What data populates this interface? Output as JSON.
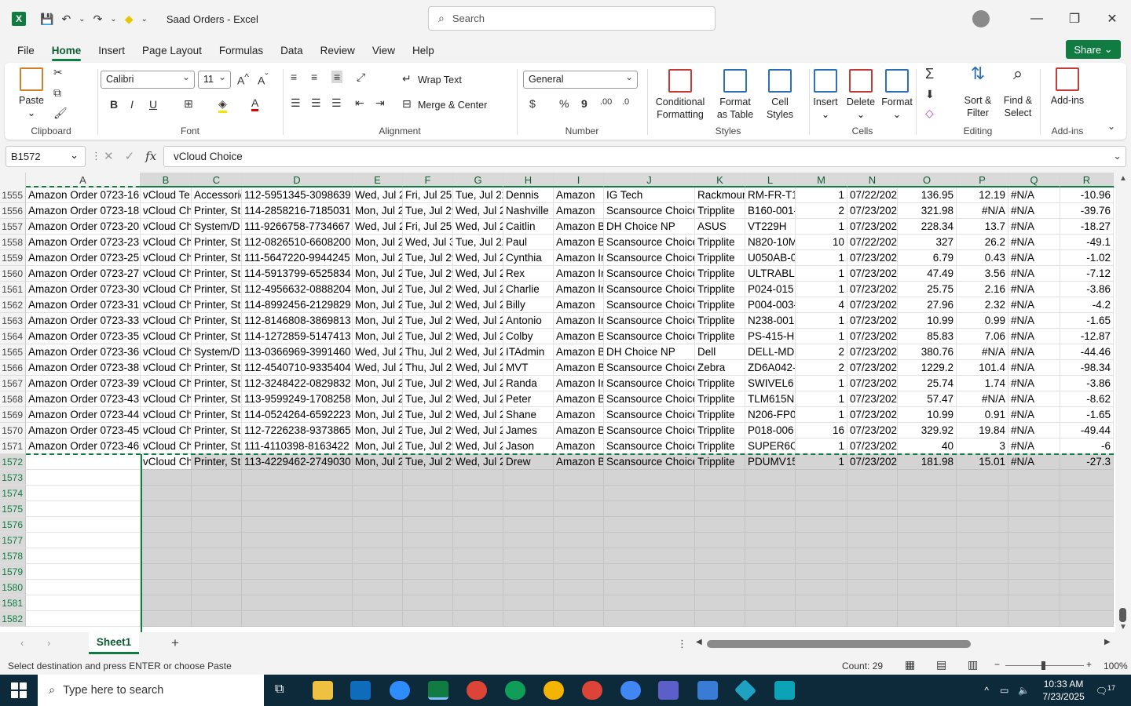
{
  "window": {
    "app_title": "Saad Orders  -  Excel",
    "search_placeholder": "Search"
  },
  "tabs": [
    "File",
    "Home",
    "Insert",
    "Page Layout",
    "Formulas",
    "Data",
    "Review",
    "View",
    "Help"
  ],
  "share_label": "Share",
  "ribbon": {
    "clipboard": {
      "paste": "Paste",
      "label": "Clipboard"
    },
    "font": {
      "name": "Calibri",
      "size": "11",
      "label": "Font"
    },
    "alignment": {
      "wrap": "Wrap Text",
      "merge": "Merge & Center",
      "label": "Alignment"
    },
    "number": {
      "format": "General",
      "label": "Number"
    },
    "styles": {
      "conditional": "Conditional Formatting",
      "table": "Format as Table",
      "cell": "Cell Styles",
      "label": "Styles"
    },
    "cells": {
      "insert": "Insert",
      "delete": "Delete",
      "format": "Format",
      "label": "Cells"
    },
    "editing": {
      "sort": "Sort & Filter",
      "find": "Find & Select",
      "label": "Editing"
    },
    "addins": {
      "addins": "Add-ins",
      "label": "Add-ins"
    }
  },
  "formula_bar": {
    "name_box": "B1572",
    "value": "vCloud Choice"
  },
  "columns": [
    "A",
    "B",
    "C",
    "D",
    "E",
    "F",
    "G",
    "H",
    "I",
    "J",
    "K",
    "L",
    "M",
    "N",
    "O",
    "P",
    "Q",
    "R"
  ],
  "rows": [
    {
      "n": "1555",
      "c": [
        "Amazon Order 0723-16",
        "vCloud Te",
        "Accessorie",
        "112-5951345-3098639",
        "Wed, Jul 2",
        "Fri, Jul 25,",
        "Tue, Jul 22",
        "Dennis",
        "Amazon",
        "IG Tech",
        "Rackmoun",
        "RM-FR-T1",
        "1",
        "07/22/202",
        "136.95",
        "12.19",
        "#N/A",
        "-10.96"
      ]
    },
    {
      "n": "1556",
      "c": [
        "Amazon Order 0723-18",
        "vCloud Ch",
        "Printer, St",
        "114-2858216-7185031",
        "Mon, Jul 2",
        "Tue, Jul 29",
        "Wed, Jul 2",
        "Nashville",
        "Amazon",
        "Scansource Choice",
        "Tripplite",
        "B160-001-",
        "2",
        "07/23/202",
        "321.98",
        "#N/A",
        "#N/A",
        "-39.76"
      ]
    },
    {
      "n": "1557",
      "c": [
        "Amazon Order 0723-20",
        "vCloud Ch",
        "System/D",
        "111-9266758-7734667",
        "Wed, Jul 2",
        "Fri, Jul 25,",
        "Wed, Jul 2",
        "Caitlin",
        "Amazon B",
        "DH Choice NP",
        "ASUS",
        "VT229H",
        "1",
        "07/23/202",
        "228.34",
        "13.7",
        "#N/A",
        "-18.27"
      ]
    },
    {
      "n": "1558",
      "c": [
        "Amazon Order 0723-23",
        "vCloud Ch",
        "Printer, St",
        "112-0826510-6608200",
        "Mon, Jul 2",
        "Wed, Jul 3",
        "Tue, Jul 22",
        "Paul",
        "Amazon B",
        "Scansource Choice",
        "Tripplite",
        "N820-10M",
        "10",
        "07/22/202",
        "327",
        "26.2",
        "#N/A",
        "-49.1"
      ]
    },
    {
      "n": "1559",
      "c": [
        "Amazon Order 0723-25",
        "vCloud Ch",
        "Printer, St",
        "111-5647220-9944245",
        "Mon, Jul 2",
        "Tue, Jul 29",
        "Wed, Jul 2",
        "Cynthia",
        "Amazon Ir",
        "Scansource Choice",
        "Tripplite",
        "U050AB-0",
        "1",
        "07/23/202",
        "6.79",
        "0.43",
        "#N/A",
        "-1.02"
      ]
    },
    {
      "n": "1560",
      "c": [
        "Amazon Order 0723-27",
        "vCloud Ch",
        "Printer, St",
        "114-5913799-6525834",
        "Mon, Jul 2",
        "Tue, Jul 29",
        "Wed, Jul 2",
        "Rex",
        "Amazon Ir",
        "Scansource Choice",
        "Tripplite",
        "ULTRABLC",
        "1",
        "07/23/202",
        "47.49",
        "3.56",
        "#N/A",
        "-7.12"
      ]
    },
    {
      "n": "1561",
      "c": [
        "Amazon Order 0723-30",
        "vCloud Ch",
        "Printer, St",
        "112-4956632-0888204",
        "Mon, Jul 2",
        "Tue, Jul 29",
        "Wed, Jul 2",
        "Charlie",
        "Amazon Ir",
        "Scansource Choice",
        "Tripplite",
        "P024-015",
        "1",
        "07/23/202",
        "25.75",
        "2.16",
        "#N/A",
        "-3.86"
      ]
    },
    {
      "n": "1562",
      "c": [
        "Amazon Order 0723-31",
        "vCloud Ch",
        "Printer, St",
        "114-8992456-2129829",
        "Mon, Jul 2",
        "Tue, Jul 29",
        "Wed, Jul 2",
        "Billy",
        "Amazon",
        "Scansource Choice",
        "Tripplite",
        "P004-003-",
        "4",
        "07/23/202",
        "27.96",
        "2.32",
        "#N/A",
        "-4.2"
      ]
    },
    {
      "n": "1563",
      "c": [
        "Amazon Order 0723-33",
        "vCloud Ch",
        "Printer, St",
        "112-8146808-3869813",
        "Mon, Jul 2",
        "Tue, Jul 29",
        "Wed, Jul 2",
        "Antonio",
        "Amazon Ir",
        "Scansource Choice",
        "Tripplite",
        "N238-001-",
        "1",
        "07/23/202",
        "10.99",
        "0.99",
        "#N/A",
        "-1.65"
      ]
    },
    {
      "n": "1564",
      "c": [
        "Amazon Order 0723-35",
        "vCloud Ch",
        "Printer, St",
        "114-1272859-5147413",
        "Mon, Jul 2",
        "Tue, Jul 29",
        "Wed, Jul 2",
        "Colby",
        "Amazon B",
        "Scansource Choice",
        "Tripplite",
        "PS-415-HG",
        "1",
        "07/23/202",
        "85.83",
        "7.06",
        "#N/A",
        "-12.87"
      ]
    },
    {
      "n": "1565",
      "c": [
        "Amazon Order 0723-36",
        "vCloud Ch",
        "System/D",
        "113-0366969-3991460",
        "Wed, Jul 2",
        "Thu, Jul 24",
        "Wed, Jul 2",
        "ITAdmin",
        "Amazon B",
        "DH Choice NP",
        "Dell",
        "DELL-MDS",
        "2",
        "07/23/202",
        "380.76",
        "#N/A",
        "#N/A",
        "-44.46"
      ]
    },
    {
      "n": "1566",
      "c": [
        "Amazon Order 0723-38",
        "vCloud Ch",
        "Printer, St",
        "112-4540710-9335404",
        "Wed, Jul 2",
        "Thu, Jul 24",
        "Wed, Jul 2",
        "MVT",
        "Amazon B",
        "Scansource Choice",
        "Zebra",
        "ZD6A042-I",
        "2",
        "07/23/202",
        "1229.2",
        "101.4",
        "#N/A",
        "-98.34"
      ]
    },
    {
      "n": "1567",
      "c": [
        "Amazon Order 0723-39",
        "vCloud Ch",
        "Printer, St",
        "112-3248422-0829832",
        "Mon, Jul 2",
        "Tue, Jul 29",
        "Wed, Jul 2",
        "Randa",
        "Amazon Ir",
        "Scansource Choice",
        "Tripplite",
        "SWIVEL6",
        "1",
        "07/23/202",
        "25.74",
        "1.74",
        "#N/A",
        "-3.86"
      ]
    },
    {
      "n": "1568",
      "c": [
        "Amazon Order 0723-43",
        "vCloud Ch",
        "Printer, St",
        "113-9599249-1708258",
        "Mon, Jul 2",
        "Tue, Jul 29",
        "Wed, Jul 2",
        "Peter",
        "Amazon B",
        "Scansource Choice",
        "Tripplite",
        "TLM615NC",
        "1",
        "07/23/202",
        "57.47",
        "#N/A",
        "#N/A",
        "-8.62"
      ]
    },
    {
      "n": "1569",
      "c": [
        "Amazon Order 0723-44",
        "vCloud Ch",
        "Printer, St",
        "114-0524264-6592223",
        "Mon, Jul 2",
        "Tue, Jul 29",
        "Wed, Jul 2",
        "Shane",
        "Amazon",
        "Scansource Choice",
        "Tripplite",
        "N206-FP0",
        "1",
        "07/23/202",
        "10.99",
        "0.91",
        "#N/A",
        "-1.65"
      ]
    },
    {
      "n": "1570",
      "c": [
        "Amazon Order 0723-45",
        "vCloud Ch",
        "Printer, St",
        "112-7226238-9373865",
        "Mon, Jul 2",
        "Tue, Jul 29",
        "Wed, Jul 2",
        "James",
        "Amazon B",
        "Scansource Choice",
        "Tripplite",
        "P018-006",
        "16",
        "07/23/202",
        "329.92",
        "19.84",
        "#N/A",
        "-49.44"
      ]
    },
    {
      "n": "1571",
      "c": [
        "Amazon Order 0723-46",
        "vCloud Ch",
        "Printer, St",
        "111-4110398-8163422",
        "Mon, Jul 2",
        "Tue, Jul 29",
        "Wed, Jul 2",
        "Jason",
        "Amazon",
        "Scansource Choice",
        "Tripplite",
        "SUPER6ON",
        "1",
        "07/23/202",
        "40",
        "3",
        "#N/A",
        "-6"
      ]
    },
    {
      "n": "1572",
      "c": [
        "",
        "vCloud Ch",
        "Printer, St",
        "113-4229462-2749030",
        "Mon, Jul 2",
        "Tue, Jul 29",
        "Wed, Jul 2",
        "Drew",
        "Amazon B",
        "Scansource Choice",
        "Tripplite",
        "PDUMV15",
        "1",
        "07/23/202",
        "181.98",
        "15.01",
        "#N/A",
        "-27.3"
      ]
    },
    {
      "n": "1573",
      "c": []
    },
    {
      "n": "1574",
      "c": []
    },
    {
      "n": "1575",
      "c": []
    },
    {
      "n": "1576",
      "c": []
    },
    {
      "n": "1577",
      "c": []
    },
    {
      "n": "1578",
      "c": []
    },
    {
      "n": "1579",
      "c": []
    },
    {
      "n": "1580",
      "c": []
    },
    {
      "n": "1581",
      "c": []
    },
    {
      "n": "1582",
      "c": []
    }
  ],
  "sheet_tab": "Sheet1",
  "status": {
    "message": "Select destination and press ENTER or choose Paste",
    "count": "Count: 29",
    "zoom": "100%"
  },
  "taskbar": {
    "search_placeholder": "Type here to search",
    "time": "10:33 AM",
    "date": "7/23/2025",
    "notifications": "17"
  },
  "colors": {
    "excel_green": "#107c41",
    "selection_gray": "#d4d4d4",
    "taskbar": "#0d2a3b"
  }
}
